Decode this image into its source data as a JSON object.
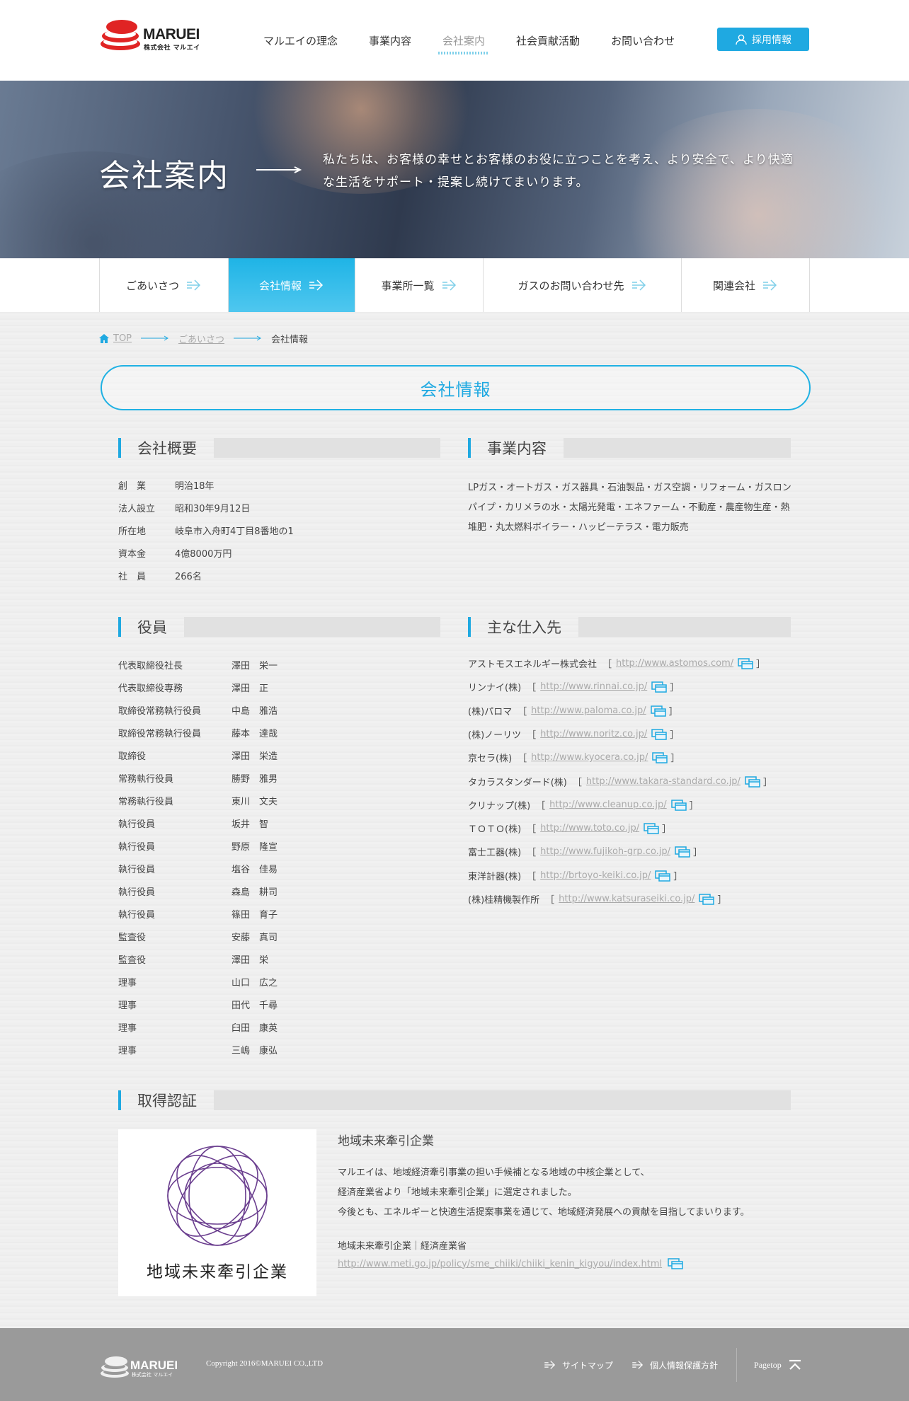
{
  "header": {
    "logo_text": "MARUEI",
    "logo_sub": "株式会社 マルエイ",
    "nav": [
      "マルエイの理念",
      "事業内容",
      "会社案内",
      "社会貢献活動",
      "お問い合わせ"
    ],
    "recruit_label": "採用情報"
  },
  "hero": {
    "title": "会社案内",
    "text": "私たちは、お客様の幸せとお客様のお役に立つことを考え、より安全で、より快適な生活をサポート・提案し続けてまいります。"
  },
  "subnav": [
    "ごあいさつ",
    "会社情報",
    "事業所一覧",
    "ガスのお問い合わせ先",
    "関連会社"
  ],
  "breadcrumb": {
    "top": "TOP",
    "parent": "ごあいさつ",
    "current": "会社情報"
  },
  "page_title": "会社情報",
  "overview": {
    "heading": "会社概要",
    "rows": [
      {
        "k": "創　業",
        "v": "明治18年"
      },
      {
        "k": "法人設立",
        "v": "昭和30年9月12日"
      },
      {
        "k": "所在地",
        "v": "岐阜市入舟町4丁目8番地の1"
      },
      {
        "k": "資本金",
        "v": "4億8000万円"
      },
      {
        "k": "社　員",
        "v": "266名"
      }
    ]
  },
  "business": {
    "heading": "事業内容",
    "text": "LPガス・オートガス・ガス器具・石油製品・ガス空調・リフォーム・ガスロンパイプ・カリメラの水・太陽光発電・エネファーム・不動産・農産物生産・熱堆肥・丸太燃料ボイラー・ハッピーテラス・電力販売"
  },
  "officers": {
    "heading": "役員",
    "rows": [
      {
        "k": "代表取締役社長",
        "v": "澤田　栄一"
      },
      {
        "k": "代表取締役専務",
        "v": "澤田　正"
      },
      {
        "k": "取締役常務執行役員",
        "v": "中島　雅浩"
      },
      {
        "k": "取締役常務執行役員",
        "v": "藤本　達哉"
      },
      {
        "k": "取締役",
        "v": "澤田　栄造"
      },
      {
        "k": "常務執行役員",
        "v": "勝野　雅男"
      },
      {
        "k": "常務執行役員",
        "v": "東川　文夫"
      },
      {
        "k": "執行役員",
        "v": "坂井　智"
      },
      {
        "k": "執行役員",
        "v": "野原　隆宣"
      },
      {
        "k": "執行役員",
        "v": "塩谷　佳易"
      },
      {
        "k": "執行役員",
        "v": "森島　耕司"
      },
      {
        "k": "執行役員",
        "v": "篠田　育子"
      },
      {
        "k": "監査役",
        "v": "安藤　真司"
      },
      {
        "k": "監査役",
        "v": "澤田　栄"
      },
      {
        "k": "理事",
        "v": "山口　広之"
      },
      {
        "k": "理事",
        "v": "田代　千尋"
      },
      {
        "k": "理事",
        "v": "臼田　康英"
      },
      {
        "k": "理事",
        "v": "三嶋　康弘"
      }
    ]
  },
  "suppliers": {
    "heading": "主な仕入先",
    "rows": [
      {
        "name": "アストモスエネルギー株式会社",
        "url": "http://www.astomos.com/"
      },
      {
        "name": "リンナイ(株)",
        "url": "http://www.rinnai.co.jp/"
      },
      {
        "name": "(株)パロマ",
        "url": "http://www.paloma.co.jp/"
      },
      {
        "name": "(株)ノーリツ",
        "url": "http://www.noritz.co.jp/"
      },
      {
        "name": "京セラ(株)",
        "url": "http://www.kyocera.co.jp/"
      },
      {
        "name": "タカラスタンダード(株)",
        "url": "http://www.takara-standard.co.jp/"
      },
      {
        "name": "クリナップ(株)",
        "url": "http://www.cleanup.co.jp/"
      },
      {
        "name": "ＴＯＴＯ(株)",
        "url": "http://www.toto.co.jp/"
      },
      {
        "name": "富士工器(株)",
        "url": "http://www.fujikoh-grp.co.jp/"
      },
      {
        "name": "東洋計器(株)",
        "url": "http://brtoyo-keiki.co.jp/"
      },
      {
        "name": "(株)桂精機製作所",
        "url": "http://www.katsuraseiki.co.jp/"
      }
    ]
  },
  "certification": {
    "heading": "取得認証",
    "emblem_caption": "地域未来牽引企業",
    "title": "地域未来牽引企業",
    "lines": [
      "マルエイは、地域経済牽引事業の担い手候補となる地域の中核企業として、",
      "経済産業省より「地域未来牽引企業」に選定されました。",
      "今後とも、エネルギーと快適生活提案事業を通じて、地域経済発展への貢献を目指してまいります。"
    ],
    "source": "地域未来牽引企業｜経済産業省",
    "url": "http://www.meti.go.jp/policy/sme_chiiki/chiiki_kenin_kigyou/index.html"
  },
  "footer": {
    "logo_text": "MARUEI",
    "logo_sub": "株式会社 マルエイ",
    "copyright": "Copyright 2016©MARUEI CO.,LTD",
    "sitemap": "サイトマップ",
    "privacy": "個人情報保護方針",
    "pagetop": "Pagetop"
  },
  "colors": {
    "accent": "#1fa9e1",
    "brand_red": "#e02424",
    "footer": "#9a9a9a"
  }
}
